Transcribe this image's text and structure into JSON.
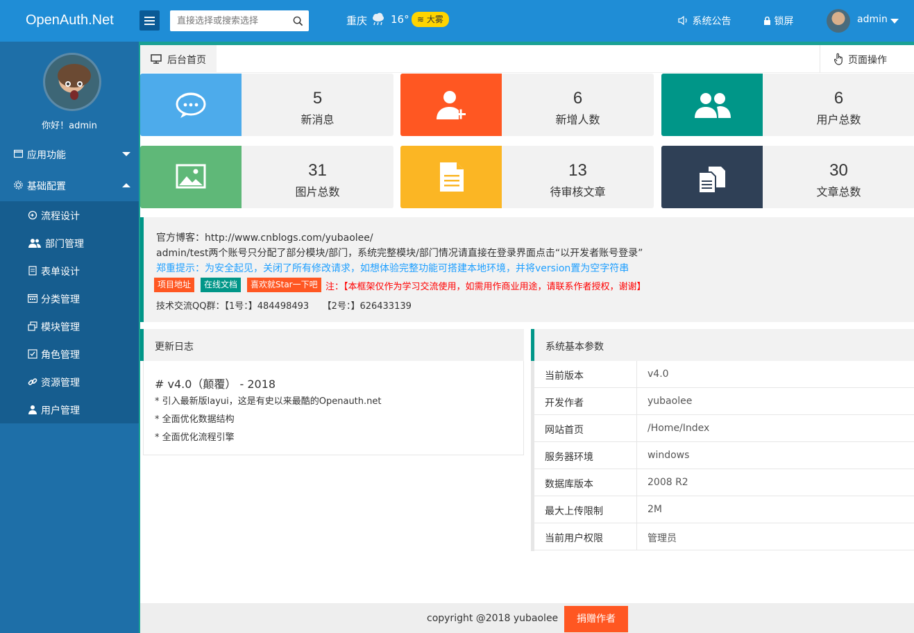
{
  "header": {
    "logo": "OpenAuth.Net",
    "search_placeholder": "直接选择或搜索选择",
    "weather": {
      "city": "重庆",
      "temp": "16°",
      "badge": "大雾"
    },
    "notice": "系统公告",
    "lock": "锁屏",
    "user": "admin"
  },
  "sidebar": {
    "greeting": "你好！admin",
    "groups": [
      {
        "label": "应用功能",
        "icon": "window-icon"
      },
      {
        "label": "基础配置",
        "icon": "gear-icon"
      }
    ],
    "items": [
      {
        "label": "流程设计",
        "icon": "flow-icon"
      },
      {
        "label": "部门管理",
        "icon": "users-icon"
      },
      {
        "label": "表单设计",
        "icon": "form-icon"
      },
      {
        "label": "分类管理",
        "icon": "calendar-icon"
      },
      {
        "label": "模块管理",
        "icon": "modules-icon"
      },
      {
        "label": "角色管理",
        "icon": "checkbox-icon"
      },
      {
        "label": "资源管理",
        "icon": "link-icon"
      },
      {
        "label": "用户管理",
        "icon": "user-icon"
      }
    ]
  },
  "tabs": {
    "home": "后台首页",
    "page_ops": "页面操作"
  },
  "cards": [
    {
      "value": "5",
      "label": "新消息",
      "color": "#4dabeb",
      "icon": "chat-icon"
    },
    {
      "value": "6",
      "label": "新增人数",
      "color": "#ff5722",
      "icon": "add-user-icon"
    },
    {
      "value": "6",
      "label": "用户总数",
      "color": "#009688",
      "icon": "group-icon"
    },
    {
      "value": "31",
      "label": "图片总数",
      "color": "#5fb878",
      "icon": "image-icon"
    },
    {
      "value": "13",
      "label": "待审核文章",
      "color": "#fbb624",
      "icon": "document-icon"
    },
    {
      "value": "30",
      "label": "文章总数",
      "color": "#2f4056",
      "icon": "files-icon"
    }
  ],
  "notice": {
    "blog": "官方博客：http://www.cnblogs.com/yubaolee/",
    "accounts": "admin/test两个账号只分配了部分模块/部门，系统完整模块/部门情况请直接在登录界面点击“以开发者账号登录”",
    "tip": "郑重提示：为安全起见，关闭了所有修改请求，如想体验完整功能可搭建本地环境，并将version置为空字符串",
    "btn_project": "项目地址",
    "btn_docs": "在线文档",
    "btn_star": "喜欢就Star一下吧",
    "warning": "注：【本框架仅作为学习交流使用，如需用作商业用途，请联系作者授权，谢谢】",
    "qq": "技术交流QQ群：【1号：】484498493　　【2号：】626433139"
  },
  "changelog": {
    "title": "更新日志",
    "version": "# v4.0（颠覆） - 2018",
    "items": [
      "* 引入最新版layui，这是有史以来最酷的Openauth.net",
      "* 全面优化数据结构",
      "* 全面优化流程引擎"
    ]
  },
  "params": {
    "title": "系统基本参数",
    "rows": [
      {
        "k": "当前版本",
        "v": "v4.0"
      },
      {
        "k": "开发作者",
        "v": "yubaolee"
      },
      {
        "k": "网站首页",
        "v": "/Home/Index"
      },
      {
        "k": "服务器环境",
        "v": "windows"
      },
      {
        "k": "数据库版本",
        "v": "2008 R2"
      },
      {
        "k": "最大上传限制",
        "v": "2M"
      },
      {
        "k": "当前用户权限",
        "v": "管理员"
      }
    ]
  },
  "footer": {
    "copyright": "copyright @2018 yubaolee",
    "donate": "捐赠作者"
  }
}
